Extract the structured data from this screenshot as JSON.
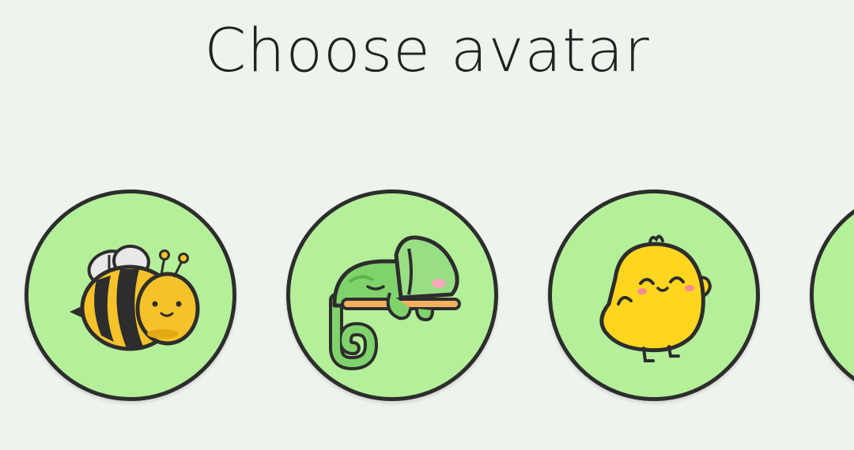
{
  "header": {
    "title": "Choose avatar"
  },
  "avatars": [
    {
      "icon": "bee-icon"
    },
    {
      "icon": "chameleon-icon"
    },
    {
      "icon": "chick-icon"
    },
    {
      "icon": "avatar-icon"
    }
  ],
  "colors": {
    "background": "#eef3ee",
    "avatar_fill": "#b4f09a",
    "avatar_border": "#2d2d2d",
    "title_text": "#222222"
  }
}
